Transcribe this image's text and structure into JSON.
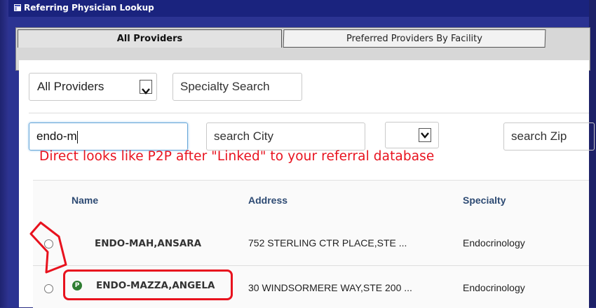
{
  "window": {
    "title": "Referring Physician Lookup"
  },
  "tabs": [
    {
      "label": "All Providers",
      "active": true
    },
    {
      "label": "Preferred Providers By Facility",
      "active": false
    }
  ],
  "filters": {
    "provider_select": {
      "value": "All Providers"
    },
    "specialty_search": {
      "placeholder": "Specialty Search"
    },
    "name_search": {
      "value": "endo-m"
    },
    "city_search": {
      "placeholder": "search City"
    },
    "state_select": {
      "value": ""
    },
    "zip_search": {
      "placeholder": "search Zip"
    }
  },
  "results": {
    "columns": [
      "Name",
      "Address",
      "Specialty"
    ],
    "rows": [
      {
        "name": "ENDO-MAH,ANSARA",
        "address": "752 STERLING CTR PLACE,STE ...",
        "specialty": "Endocrinology",
        "preferred": false
      },
      {
        "name": "ENDO-MAZZA,ANGELA",
        "address": "30 WINDSORMERE WAY,STE 200 ...",
        "specialty": "Endocrinology",
        "preferred": true,
        "badge": "P"
      }
    ]
  },
  "annotation": {
    "text": "Direct looks like P2P after \"Linked\" to your referral database",
    "color": "#e8121e"
  },
  "colors": {
    "window_bg": "#2b3392",
    "header_text": "#2d4a73",
    "focus_border": "#68a7d8",
    "preferred_badge": "#2e7d32"
  }
}
